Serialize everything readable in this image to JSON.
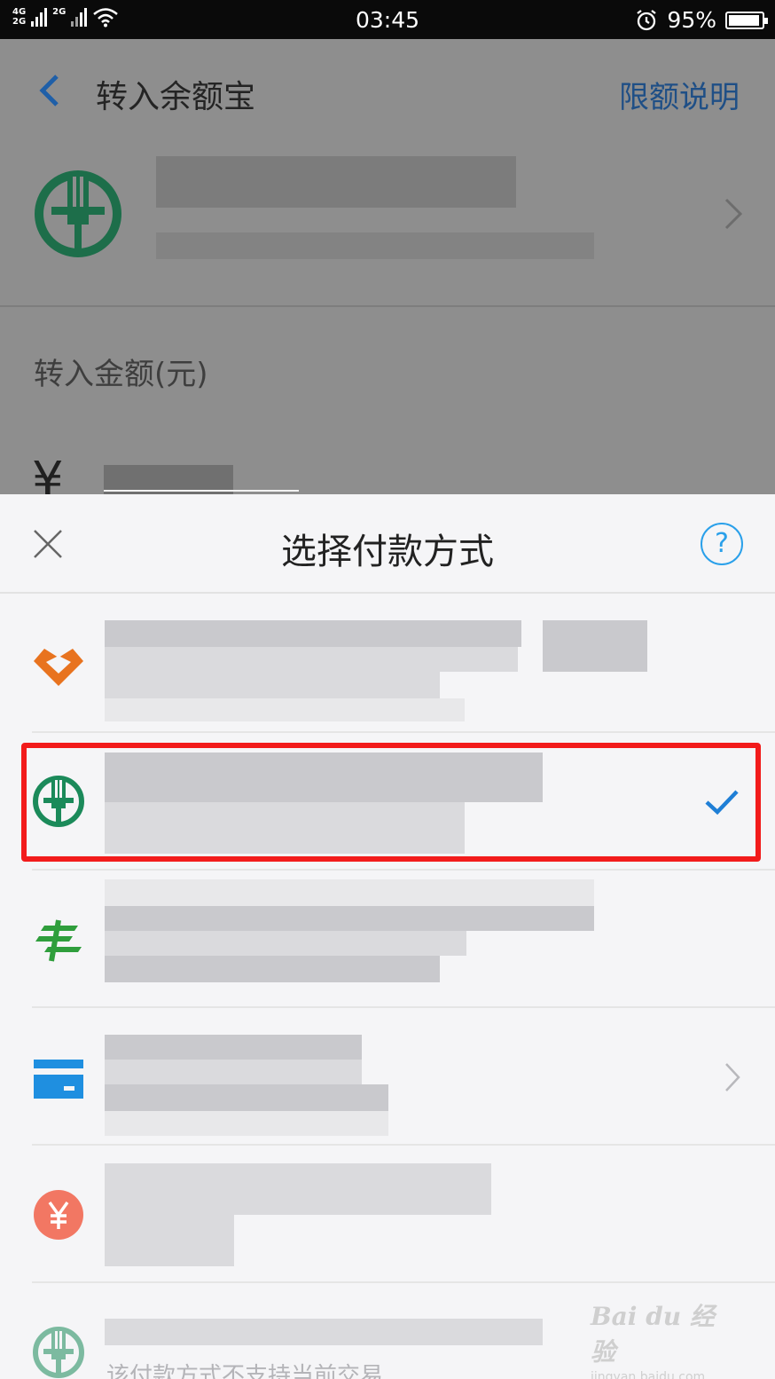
{
  "status_bar": {
    "network_top": "4G",
    "network_bottom": "2G",
    "network2": "2G",
    "time": "03:45",
    "battery": "95%",
    "icons": [
      "signal-icon",
      "wifi-icon",
      "alarm-icon",
      "battery-icon"
    ]
  },
  "background_page": {
    "title": "转入余额宝",
    "limit_link": "限额说明",
    "amount_label": "转入金额(元)",
    "currency": "¥",
    "bank_icon": "abc-bank-logo"
  },
  "sheet": {
    "title": "选择付款方式",
    "help_symbol": "?",
    "selected_index": 1,
    "methods": [
      {
        "icon": "bank-of-communications-logo",
        "color": "#e8731f"
      },
      {
        "icon": "abc-bank-logo",
        "color": "#1b8a5a",
        "selected": true
      },
      {
        "icon": "postal-savings-bank-logo",
        "color": "#2f9e3c"
      },
      {
        "icon": "card-icon",
        "color": "#1f8fe0"
      },
      {
        "icon": "yen-coin-icon",
        "color": "#f27763"
      },
      {
        "icon": "abc-bank-logo",
        "color": "#1b8a5a"
      }
    ],
    "footer_text": "该付款方式不支持当前交易"
  },
  "watermark": {
    "main": "Bai du 经验",
    "sub": "jingyan.baidu.com"
  },
  "colors": {
    "accent": "#2aa0ea",
    "highlight": "#f21b1b",
    "dim_overlay": "#8e8e8e"
  }
}
